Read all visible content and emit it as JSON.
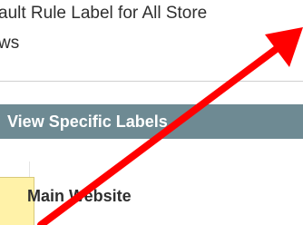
{
  "top": {
    "text": "ault Rule Label for All Store\nws"
  },
  "section": {
    "title": "View Specific Labels"
  },
  "content": {
    "website_label": "Main Website"
  },
  "colors": {
    "section_header": "#6e8a93",
    "arrow": "#ff0000",
    "sticky_note": "#fff2a8"
  }
}
